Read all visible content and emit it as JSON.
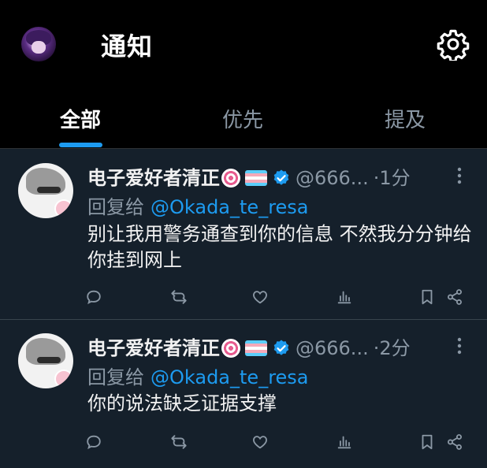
{
  "header": {
    "title": "通知",
    "settings_icon": "gear-icon"
  },
  "tabs": [
    {
      "label": "全部",
      "active": true
    },
    {
      "label": "优先",
      "active": false
    },
    {
      "label": "提及",
      "active": false
    }
  ],
  "colors": {
    "accent": "#1d9bf0",
    "background_feed": "#15202b",
    "background_header": "#000000",
    "muted": "#8b98a5"
  },
  "tweets": [
    {
      "name": "电子爱好者清正",
      "handle": "@666...",
      "dot": "·",
      "time": "1分",
      "reply_prefix": "回复给",
      "reply_to": "@Okada_te_resa",
      "text": "别让我用警务通查到你的信息 不然我分分钟给你挂到网上"
    },
    {
      "name": "电子爱好者清正",
      "handle": "@666...",
      "dot": "·",
      "time": "2分",
      "reply_prefix": "回复给",
      "reply_to": "@Okada_te_resa",
      "text": "你的说法缺乏证据支撑"
    }
  ]
}
